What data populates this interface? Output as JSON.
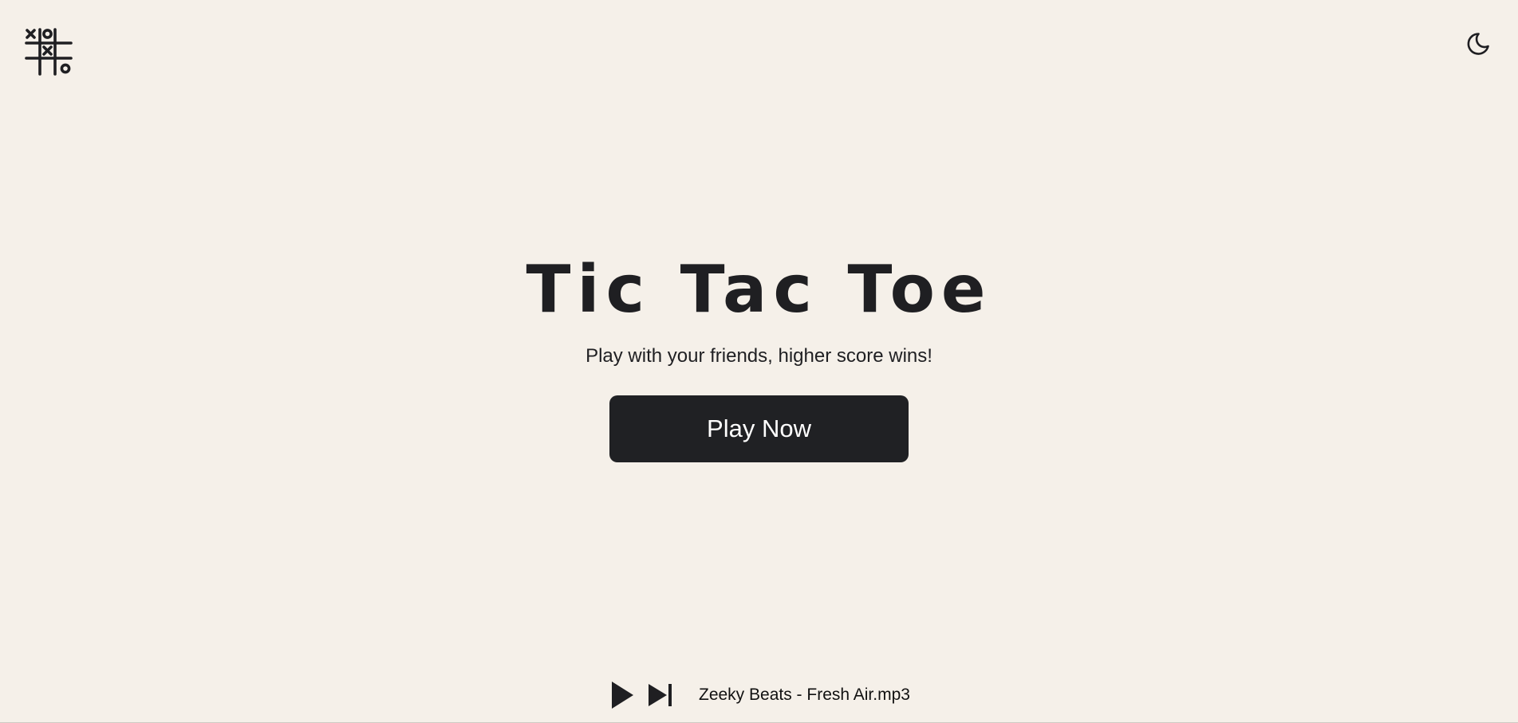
{
  "header": {
    "logo_icon": "tic-tac-toe-grid-icon",
    "theme_toggle_icon": "moon-icon"
  },
  "hero": {
    "title": "Tic Tac Toe",
    "subtitle": "Play with your friends, higher score wins!",
    "play_button_label": "Play Now"
  },
  "player": {
    "play_icon": "play-icon",
    "next_icon": "skip-next-icon",
    "track": "Zeeky Beats - Fresh Air.mp3"
  },
  "colors": {
    "background": "#f5f0e9",
    "primary_dark": "#202124",
    "button_text": "#ffffff"
  }
}
